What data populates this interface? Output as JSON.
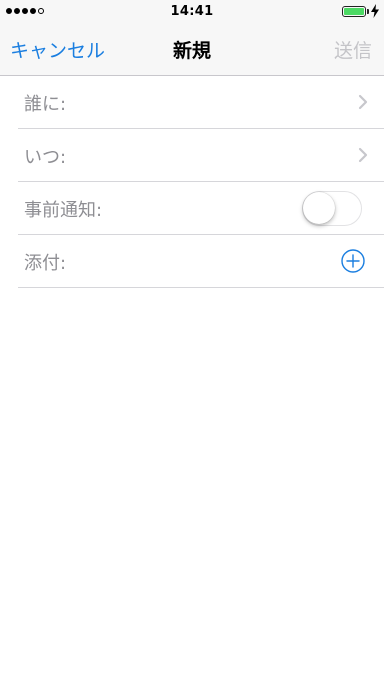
{
  "status_bar": {
    "time": "14:41",
    "signal_bars_filled": 4,
    "signal_bars_total": 5,
    "battery_level": 1.0,
    "battery_color": "#4cd964",
    "charging_icon": "bolt-icon"
  },
  "nav": {
    "cancel_label": "キャンセル",
    "title": "新規",
    "send_label": "送信"
  },
  "form": {
    "rows": [
      {
        "label": "誰に:",
        "accessory": "chevron-right-icon"
      },
      {
        "label": "いつ:",
        "accessory": "chevron-right-icon"
      },
      {
        "label": "事前通知:",
        "accessory": "toggle",
        "toggle_on": false
      },
      {
        "label": "添付:",
        "accessory": "plus-circle-icon"
      }
    ]
  },
  "colors": {
    "accent": "#1a7ee0",
    "disabled_text": "#c4c4c8",
    "label_gray": "#8e8e93"
  }
}
